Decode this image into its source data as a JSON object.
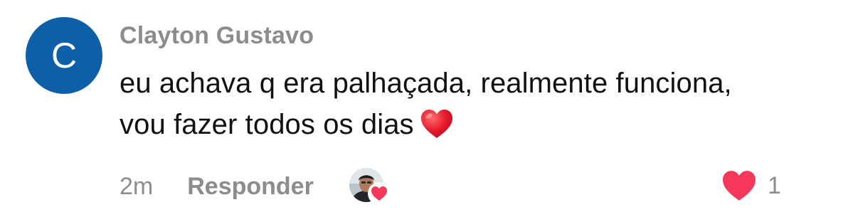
{
  "comment": {
    "avatar": {
      "letter": "C",
      "color": "#0d5fa8"
    },
    "author": "Clayton Gustavo",
    "text_line_1": "eu achava q era palhaçada, realmente funciona,",
    "text_line_2": "vou fazer todos os dias",
    "inline_emoji": "red-heart-icon",
    "time": "2m",
    "reply_label": "Responder",
    "liker_avatar_icon": "user-photo-avatar",
    "like_icon": "heart-icon",
    "like_color": "#f5385a",
    "like_count": "1"
  }
}
